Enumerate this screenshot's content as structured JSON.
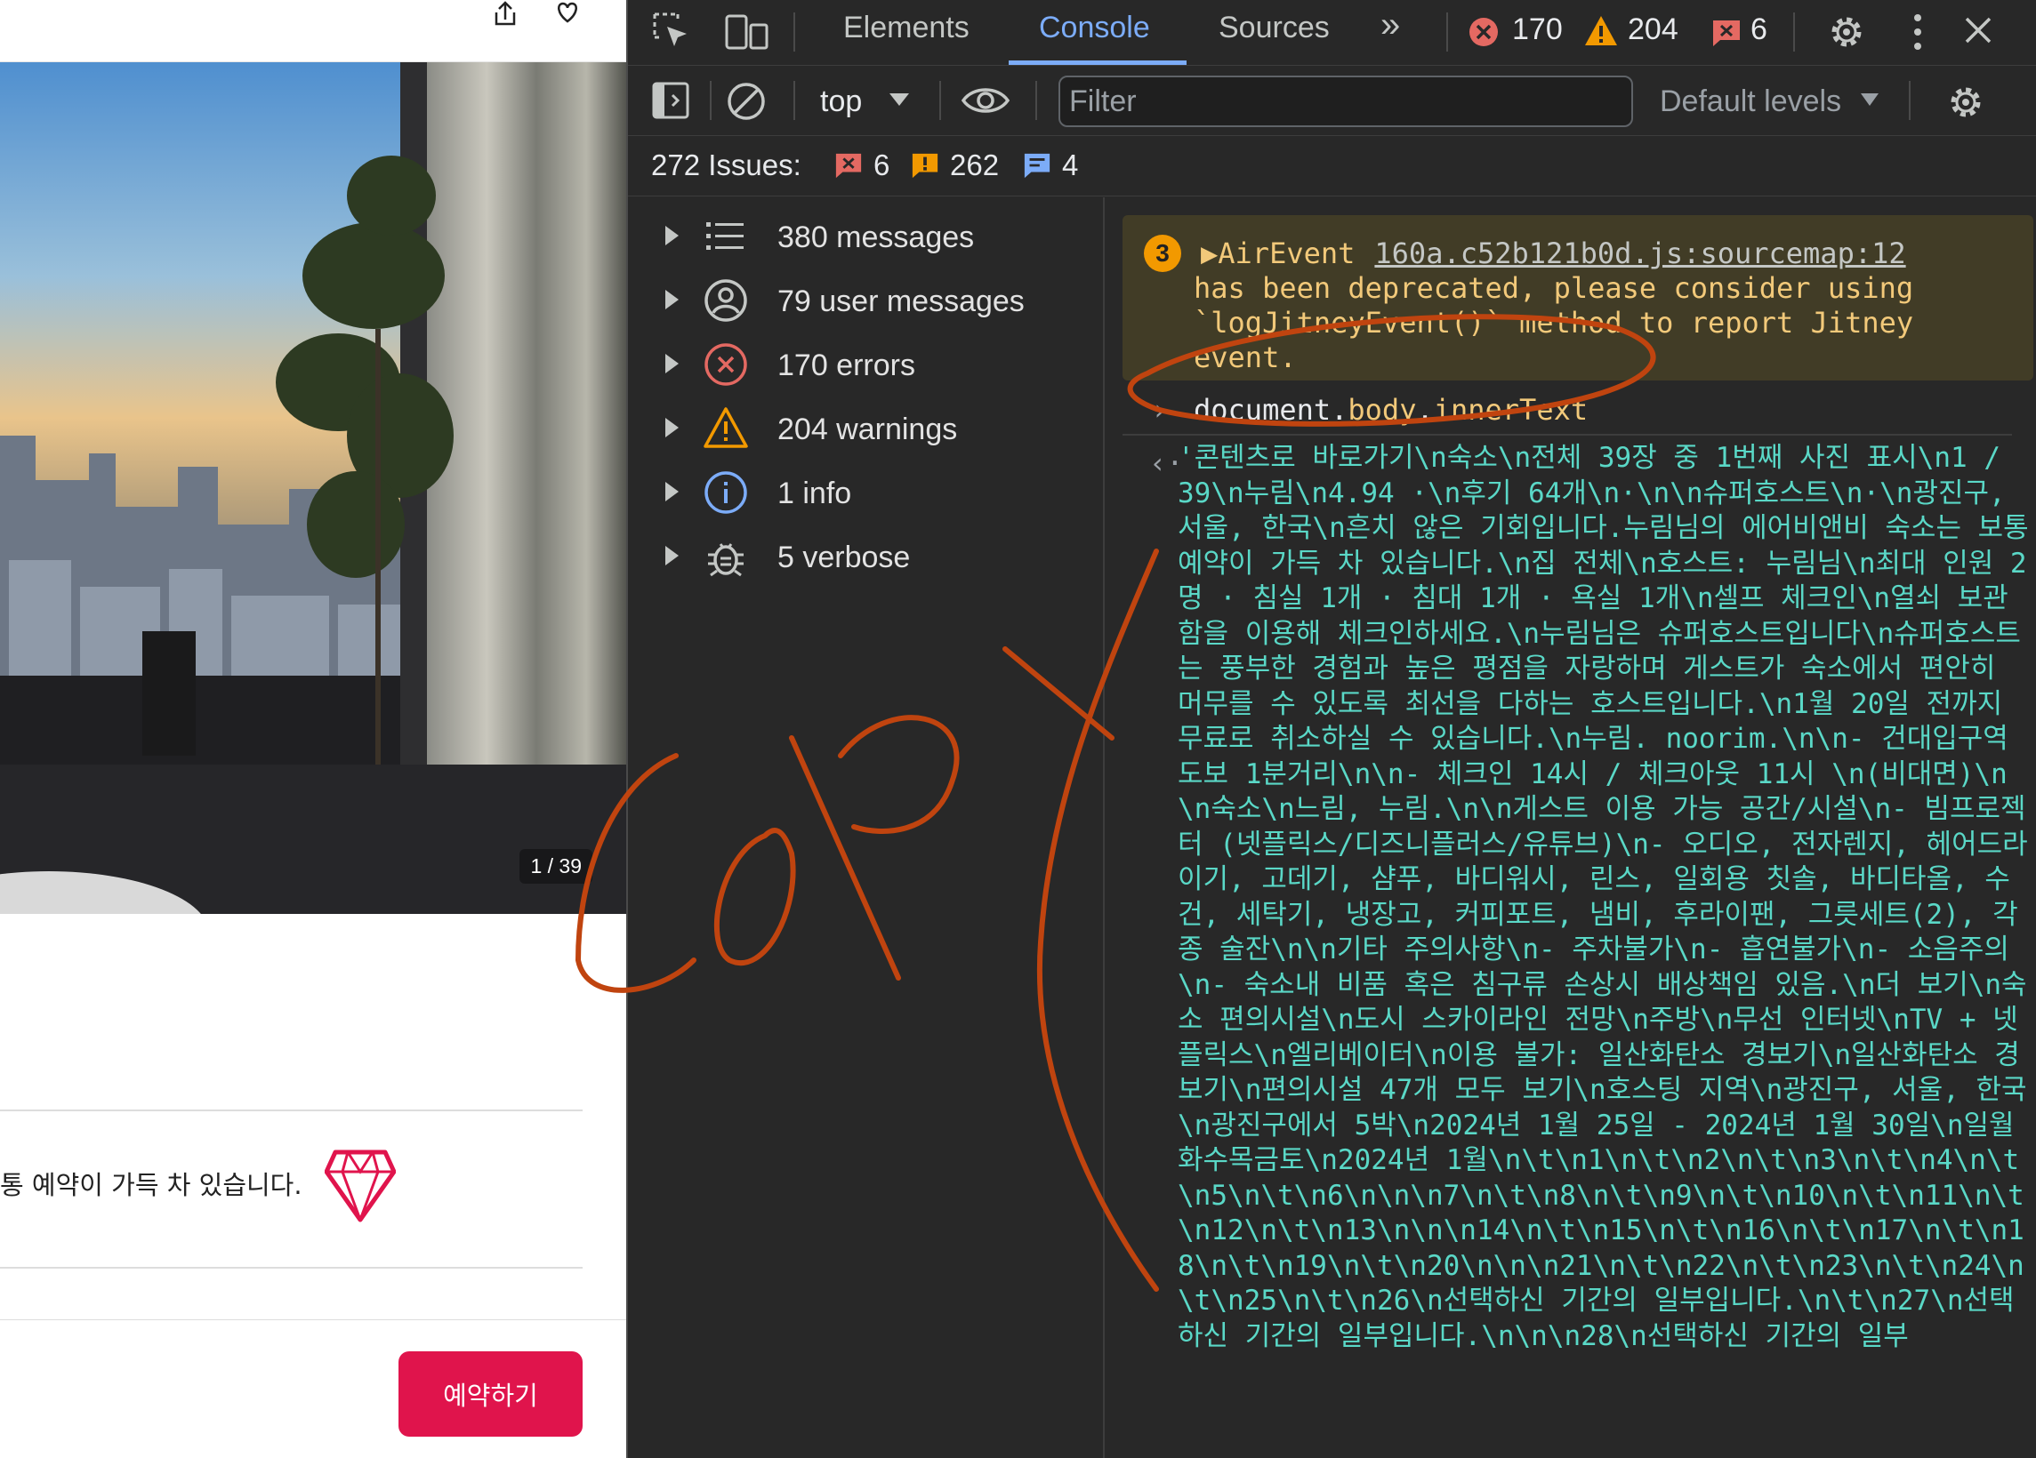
{
  "page": {
    "photo_counter": "1 / 39",
    "superhost_note": "통 예약이 가득 차 있습니다.",
    "reserve_button": "예약하기"
  },
  "devtools": {
    "tabs": [
      "Elements",
      "Console",
      "Sources"
    ],
    "active_tab": "Console",
    "counters": {
      "errors": "170",
      "warnings": "204",
      "issues": "6"
    },
    "context": "top",
    "filter_placeholder": "Filter",
    "levels": "Default levels",
    "issues_bar": {
      "label": "272 Issues:",
      "errors": "6",
      "warnings": "262",
      "info": "4"
    },
    "sidebar": [
      {
        "label": "380 messages",
        "icon": "list-icon"
      },
      {
        "label": "79 user messages",
        "icon": "user-icon"
      },
      {
        "label": "170 errors",
        "icon": "error-icon"
      },
      {
        "label": "204 warnings",
        "icon": "warning-icon"
      },
      {
        "label": "1 info",
        "icon": "info-icon"
      },
      {
        "label": "5 verbose",
        "icon": "bug-icon"
      }
    ],
    "console": {
      "warning": {
        "count": "3",
        "name": "AirEvent",
        "source": "160a.c52b121b0d.js:sourcemap:12",
        "body": "has been deprecated, please consider using `logJitneyEvent()` method to report Jitney event."
      },
      "command": {
        "object": "document.",
        "body": "body",
        "dot": ".",
        "prop": "innerText"
      },
      "result": "'콘텐츠로 바로가기\\n숙소\\n전체 39장 중 1번째 사진 표시\\n1 / 39\\n누림\\n4.94 ·\\n후기 64개\\n·\\n\\n슈퍼호스트\\n·\\n광진구, 서울, 한국\\n흔치 않은 기회입니다.누림님의 에어비앤비 숙소는 보통 예약이 가득 차 있습니다.\\n집 전체\\n호스트: 누림님\\n최대 인원 2명 · 침실 1개 · 침대 1개 · 욕실 1개\\n셀프 체크인\\n열쇠 보관함을 이용해 체크인하세요.\\n누림님은 슈퍼호스트입니다\\n슈퍼호스트는 풍부한 경험과 높은 평점을 자랑하며 게스트가 숙소에서 편안히 머무를 수 있도록 최선을 다하는 호스트입니다.\\n1월 20일 전까지 무료로 취소하실 수 있습니다.\\n누림. noorim.\\n\\n- 건대입구역 도보 1분거리\\n\\n- 체크인 14시 / 체크아웃 11시 \\n(비대면)\\n\\n숙소\\n느림, 누림.\\n\\n게스트 이용 가능 공간/시설\\n- 빔프로젝터 (넷플릭스/디즈니플러스/유튜브)\\n- 오디오, 전자렌지, 헤어드라이기, 고데기, 샴푸, 바디워시, 린스, 일회용 칫솔, 바디타올, 수건, 세탁기, 냉장고, 커피포트, 냄비, 후라이팬, 그릇세트(2), 각종 술잔\\n\\n기타 주의사항\\n- 주차불가\\n- 흡연불가\\n- 소음주의\\n- 숙소내 비품 혹은 침구류 손상시 배상책임 있음.\\n더 보기\\n숙소 편의시설\\n도시 스카이라인 전망\\n주방\\n무선 인터넷\\nTV + 넷플릭스\\n엘리베이터\\n이용 불가: 일산화탄소 경보기\\n일산화탄소 경보기\\n편의시설 47개 모두 보기\\n호스팅 지역\\n광진구, 서울, 한국\\n광진구에서 5박\\n2024년 1월 25일 - 2024년 1월 30일\\n일월화수목금토\\n2024년 1월\\n\\t\\n1\\n\\t\\n2\\n\\t\\n3\\n\\t\\n4\\n\\t\\n5\\n\\t\\n6\\n\\n\\n7\\n\\t\\n8\\n\\t\\n9\\n\\t\\n10\\n\\t\\n11\\n\\t\\n12\\n\\t\\n13\\n\\n\\n14\\n\\t\\n15\\n\\t\\n16\\n\\t\\n17\\n\\t\\n18\\n\\t\\n19\\n\\t\\n20\\n\\n\\n21\\n\\t\\n22\\n\\t\\n23\\n\\t\\n24\\n\\t\\n25\\n\\t\\n26\\n선택하신 기간의 일부입니다.\\n\\t\\n27\\n선택하신 기간의 일부입니다.\\n\\n\\n28\\n선택하신 기간의 일부"
    }
  },
  "annotation": {
    "text": "COPY",
    "color": "#c0440f"
  }
}
